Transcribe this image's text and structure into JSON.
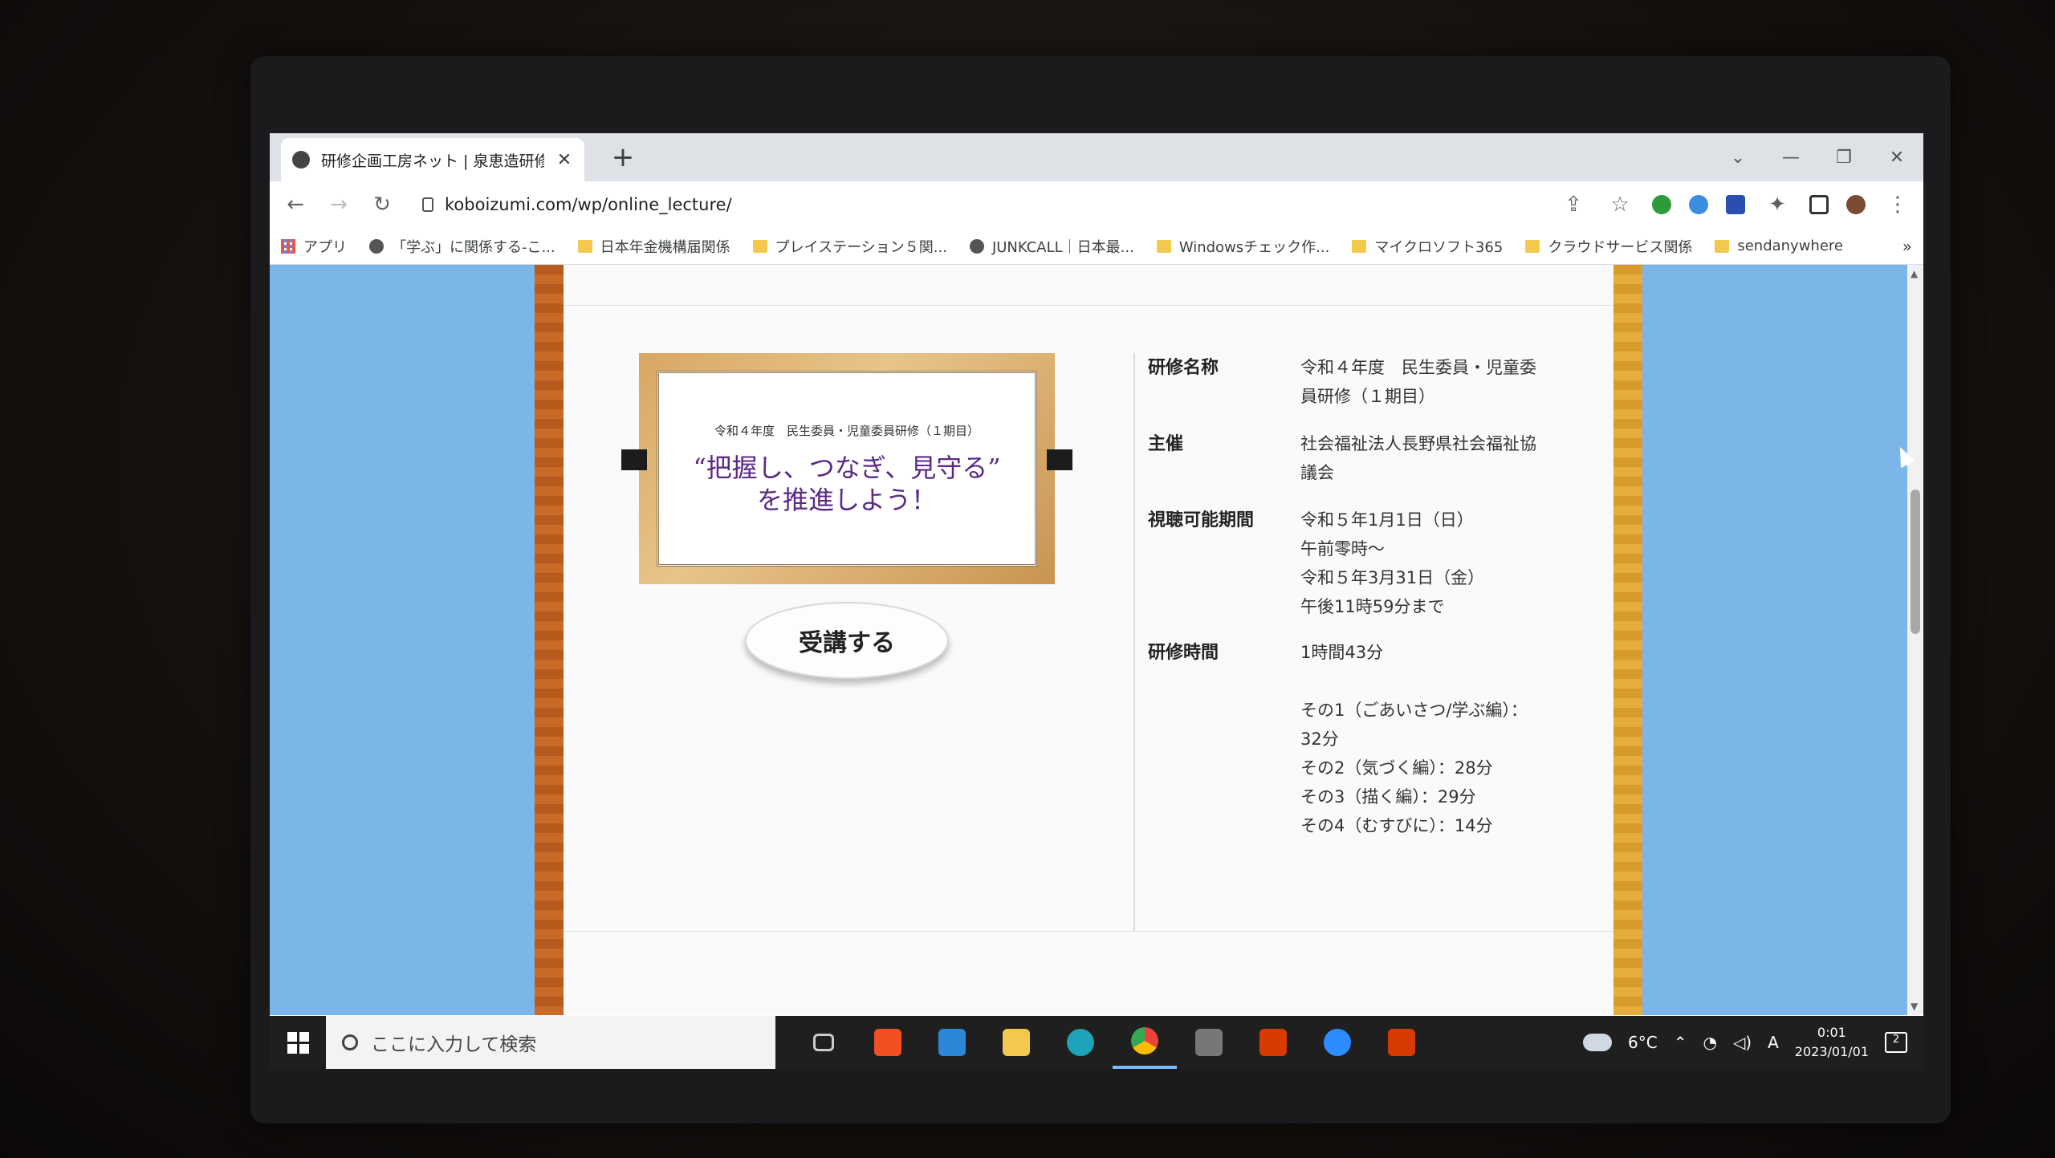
{
  "tab": {
    "title": "研修企画工房ネット | 泉恵造研修..."
  },
  "address": {
    "url": "koboizumi.com/wp/online_lecture/"
  },
  "bookmarks": [
    {
      "label": "アプリ"
    },
    {
      "label": "「学ぶ」に関係する-こ..."
    },
    {
      "label": "日本年金機構届関係"
    },
    {
      "label": "プレイステーション５関..."
    },
    {
      "label": "JUNKCALL｜日本最..."
    },
    {
      "label": "Windowsチェック作..."
    },
    {
      "label": "マイクロソフト365"
    },
    {
      "label": "クラウドサービス関係"
    },
    {
      "label": "sendanywhere"
    }
  ],
  "banner": {
    "subtitle": "令和４年度　民生委員・児童委員研修（１期目）",
    "title_line1": "“把握し、つなぎ、見守る”",
    "title_line2": "を推進しよう！"
  },
  "enroll_label": "受講する",
  "info": {
    "name_label": "研修名称",
    "name_value": "令和４年度　民生委員・児童委\n員研修（１期目）",
    "host_label": "主催",
    "host_value": "社会福祉法人長野県社会福祉協\n議会",
    "period_label": "視聴可能期間",
    "period_value": "令和５年1月1日（日）\n午前零時～\n令和５年3月31日（金）\n午後11時59分まで",
    "duration_label": "研修時間",
    "duration_value": "1時間43分\n\nその1（ごあいさつ/学ぶ編）：\n32分\nその2（気づく編）：28分\nその3（描く編）：29分\nその4（むすびに）：14分"
  },
  "taskbar": {
    "search_placeholder": "ここに入力して検索",
    "weather": "6°C",
    "ime": "A",
    "time": "0:01",
    "date": "2023/01/01",
    "notifications": "2"
  }
}
